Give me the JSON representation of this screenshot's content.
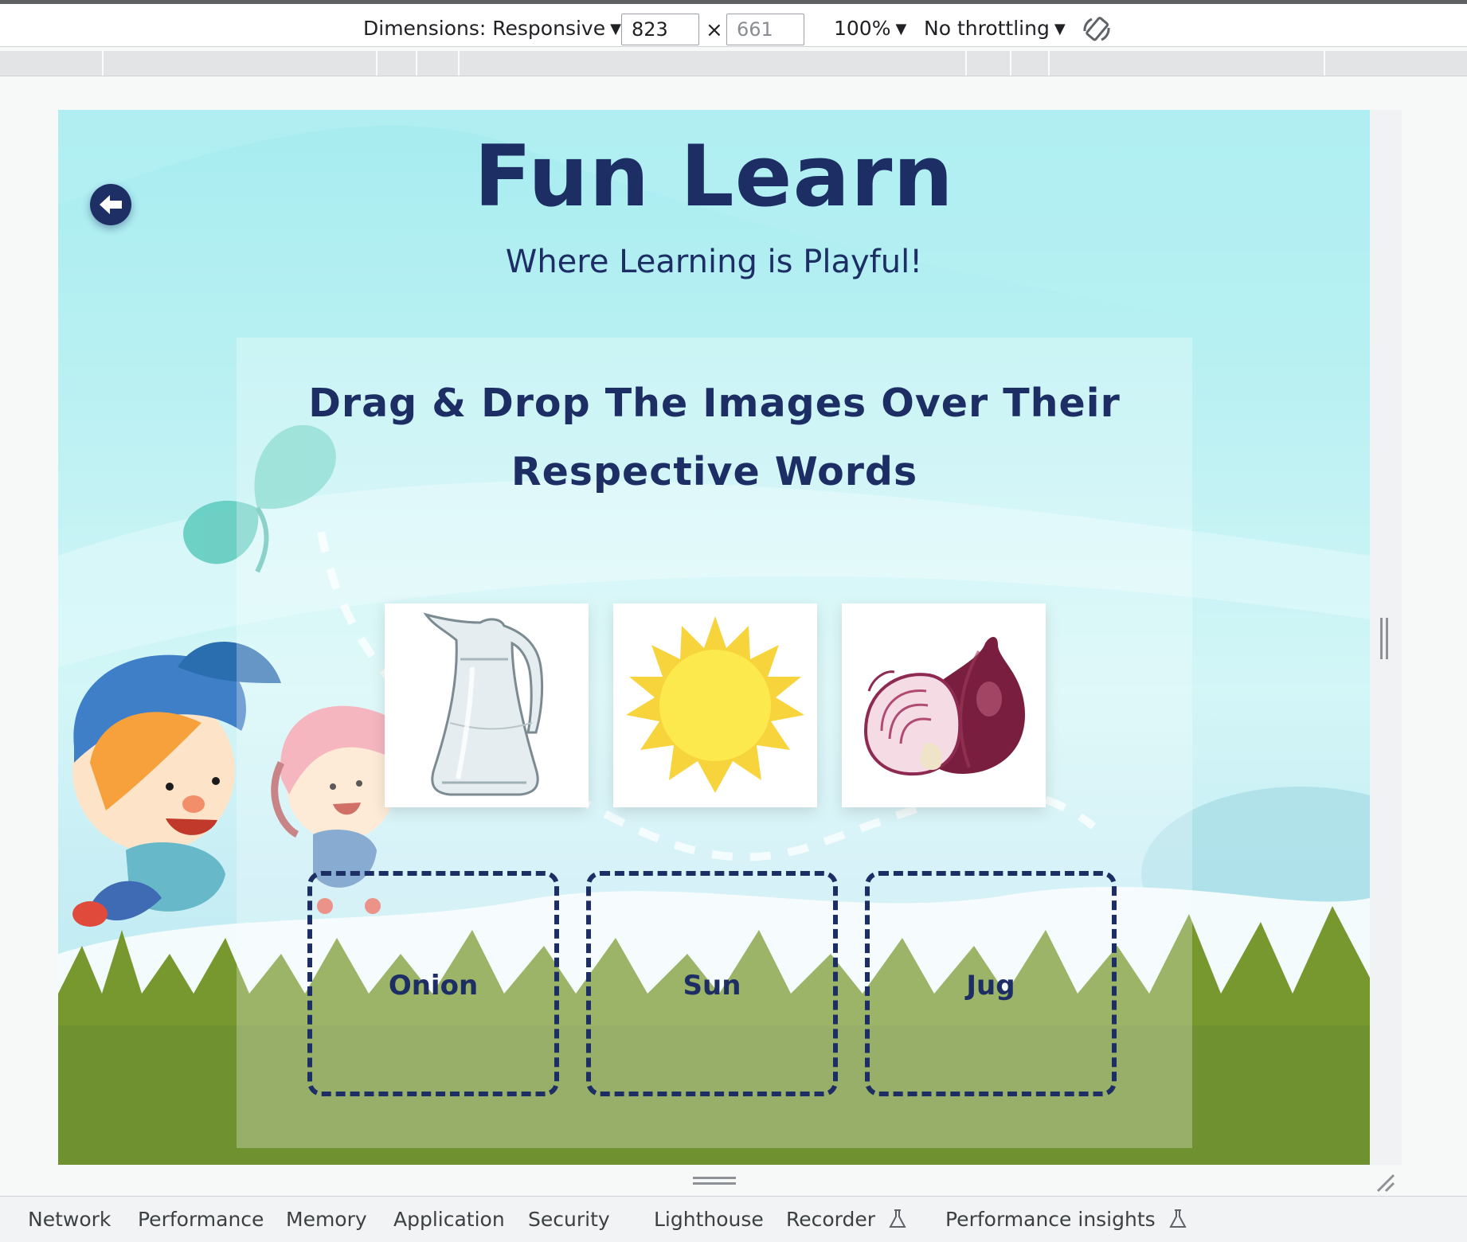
{
  "devtools": {
    "dimensions_label": "Dimensions: Responsive",
    "width_value": "823",
    "height_placeholder": "661",
    "times_symbol": "×",
    "zoom_label": "100%",
    "throttling_label": "No throttling",
    "rotate_icon": "rotate-icon"
  },
  "site": {
    "title": "Fun Learn",
    "subtitle": "Where Learning is Playful!",
    "back_icon": "arrow-left-circle-icon"
  },
  "game": {
    "instruction_line1": "Drag & Drop The Images Over Their",
    "instruction_line2": "Respective Words",
    "images": [
      {
        "name": "jug"
      },
      {
        "name": "sun"
      },
      {
        "name": "onion"
      }
    ],
    "drop_zones": [
      {
        "label": "Onion"
      },
      {
        "label": "Sun"
      },
      {
        "label": "Jug"
      }
    ]
  },
  "tabs": [
    {
      "label": "Network"
    },
    {
      "label": "Performance"
    },
    {
      "label": "Memory"
    },
    {
      "label": "Application"
    },
    {
      "label": "Security"
    },
    {
      "label": "Lighthouse"
    },
    {
      "label": "Recorder"
    },
    {
      "label": "Performance insights"
    }
  ],
  "colors": {
    "navy": "#1c2e64",
    "sky": "#a6ecf0",
    "grass": "#6f9130",
    "sun": "#fbe44a"
  }
}
